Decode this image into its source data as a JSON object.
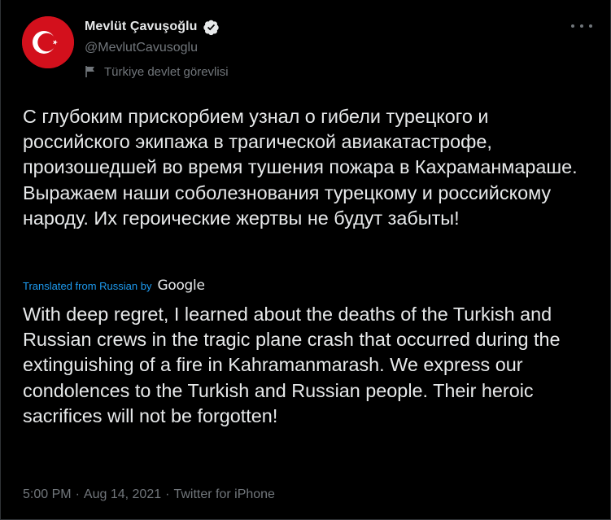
{
  "author": {
    "display_name": "Mevlüt Çavuşoğlu",
    "handle": "@MevlutCavusoglu",
    "label": "Türkiye devlet görevlisi",
    "avatar_icon": "turkish-flag-icon",
    "verified_icon": "verified-badge-icon",
    "label_icon": "flag-icon"
  },
  "menu": {
    "icon": "more-options-icon"
  },
  "tweet": {
    "original_text": "С глубоким прискорбием узнал о гибели турецкого и российского экипажа в трагической авиакатастрофе, произошедшей во время тушения пожара в Кахраманмараше. Выражаем наши соболезнования турецкому и российскому народу. Их героические жертвы не будут забыты!",
    "translated_from": "Translated from Russian by",
    "translator": "Google",
    "translated_text": "With deep regret, I learned about the deaths of the Turkish and Russian crews in the tragic plane crash that occurred during the extinguishing of a fire in Kahramanmarash. We express our condolences to the Turkish and Russian people. Their heroic sacrifices will not be forgotten!",
    "time": "5:00 PM",
    "date": "Aug 14, 2021",
    "separator": "·",
    "source": "Twitter for iPhone"
  },
  "colors": {
    "background": "#000000",
    "text": "#e7e9ea",
    "secondary": "#71767b",
    "link": "#1d9bf0",
    "avatar_red": "#d3101c"
  }
}
